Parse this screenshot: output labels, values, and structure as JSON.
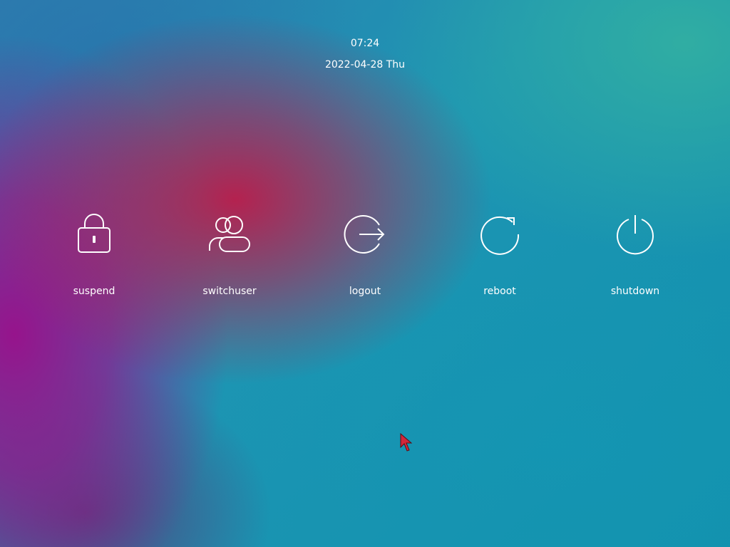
{
  "clock": {
    "time": "07:24",
    "date": "2022-04-28 Thu"
  },
  "actions": [
    {
      "label": "suspend",
      "icon": "lock-icon"
    },
    {
      "label": "switchuser",
      "icon": "users-icon"
    },
    {
      "label": "logout",
      "icon": "logout-icon"
    },
    {
      "label": "reboot",
      "icon": "reboot-icon"
    },
    {
      "label": "shutdown",
      "icon": "power-icon"
    }
  ],
  "colors": {
    "text": "#ffffff",
    "cursor": "#d3263a"
  }
}
